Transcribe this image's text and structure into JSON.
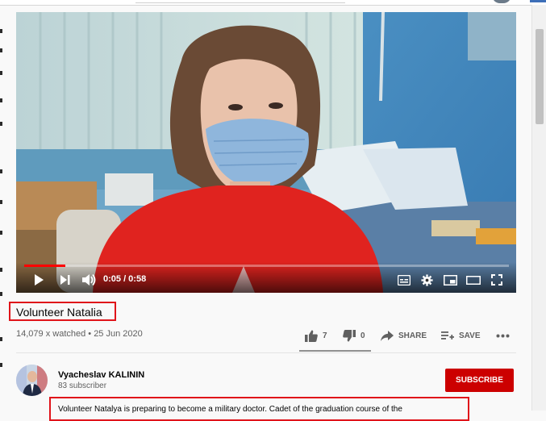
{
  "video": {
    "current_time": "0:05",
    "duration": "0:58",
    "time_display": "0:05 / 0:58",
    "progress_fraction": 0.085
  },
  "title": "Volunteer Natalia",
  "meta": "14,079 x watched • 25 Jun 2020",
  "actions": {
    "like_count": "7",
    "dislike_count": "0",
    "share_label": "SHARE",
    "save_label": "SAVE"
  },
  "channel": {
    "name": "Vyacheslav KALININ",
    "subscribers": "83 subscriber"
  },
  "subscribe_label": "SUBSCRIBE",
  "description": "Volunteer Natalya is preparing to become a military doctor. Cadet of the graduation course of the",
  "colors": {
    "accent": "#cc0000",
    "progress": "#ff0000",
    "highlight_box": "#e0141a"
  },
  "icons": [
    "play-icon",
    "next-icon",
    "volume-icon",
    "subtitles-icon",
    "settings-icon",
    "miniplayer-icon",
    "theater-icon",
    "fullscreen-icon",
    "like-icon",
    "dislike-icon",
    "share-icon",
    "save-icon",
    "more-icon"
  ]
}
